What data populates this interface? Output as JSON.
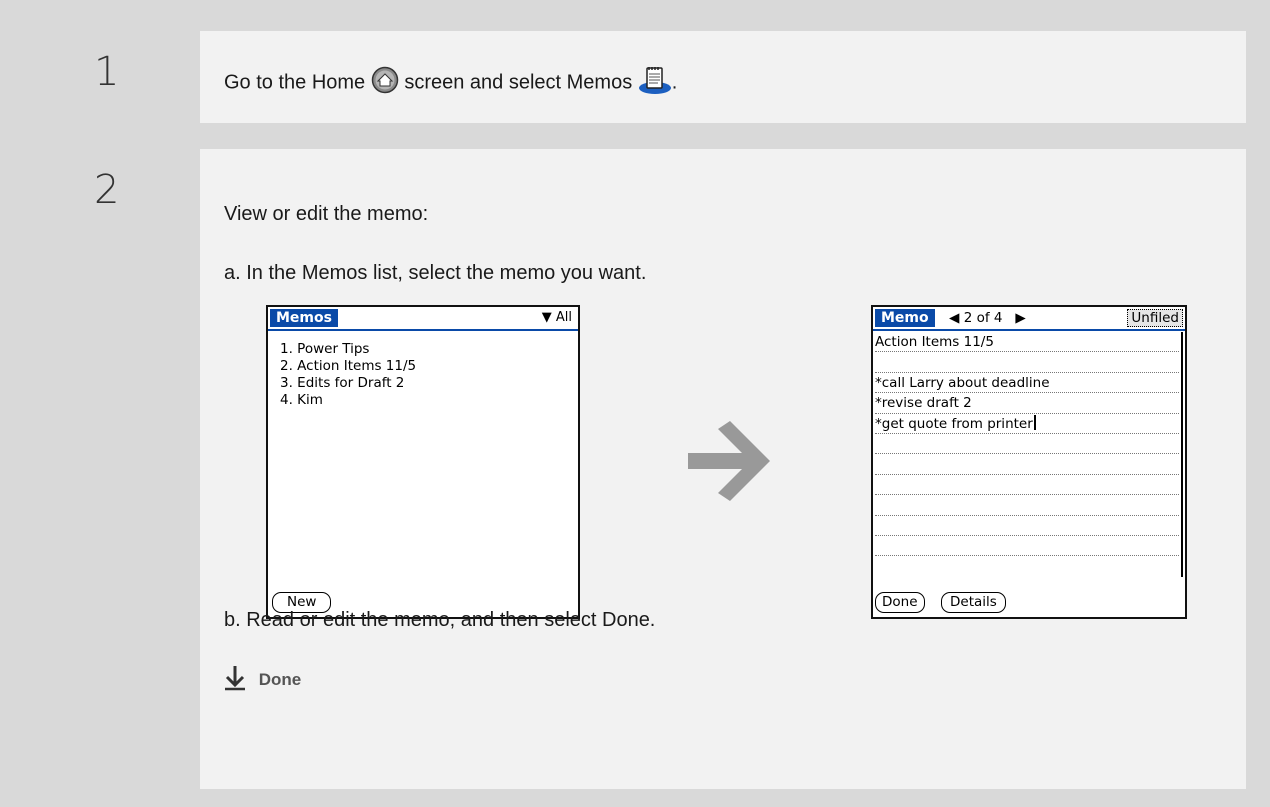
{
  "step1": {
    "number": "1",
    "text_before": "Go to the Home",
    "text_mid": "screen and select Memos",
    "text_end": "."
  },
  "step2": {
    "number": "2",
    "intro": "View or edit the memo:",
    "sub_a": "a.  In the Memos list, select the memo you want.",
    "sub_b": "b.  Read or edit the memo, and then select Done.",
    "done_label": "Done"
  },
  "memos_screen": {
    "title": "Memos",
    "category": "All",
    "items": [
      "1. Power Tips",
      "2. Action Items 11/5",
      "3. Edits for Draft 2",
      "4. Kim"
    ],
    "new_button": "New"
  },
  "memo_screen": {
    "title": "Memo",
    "position": "2 of 4",
    "category": "Unfiled",
    "lines": [
      "Action Items 11/5",
      "",
      "*call Larry about deadline",
      "*revise draft 2",
      "*get quote from printer",
      "",
      "",
      "",
      "",
      "",
      ""
    ],
    "done_button": "Done",
    "details_button": "Details"
  },
  "colors": {
    "background": "#d9d9d9",
    "panel": "#f2f2f2",
    "palm_title": "#0a4aa8",
    "arrow": "#999999"
  }
}
